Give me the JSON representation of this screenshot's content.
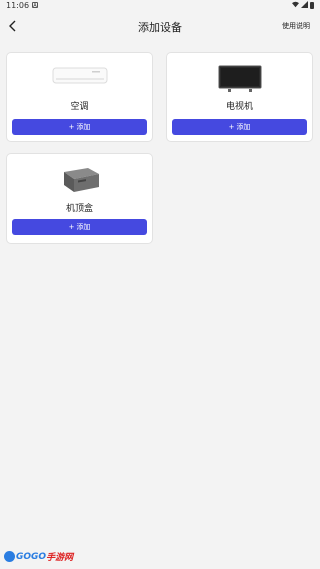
{
  "status": {
    "time": "11:06",
    "notification_icon": "A"
  },
  "header": {
    "title": "添加设备",
    "help_label": "使用说明"
  },
  "devices": [
    {
      "name": "空调",
      "icon": "air-conditioner",
      "button_label": "添加",
      "button_icon": "+"
    },
    {
      "name": "电视机",
      "icon": "television",
      "button_label": "添加",
      "button_icon": "+"
    },
    {
      "name": "机顶盒",
      "icon": "set-top-box",
      "button_label": "添加",
      "button_icon": "+"
    }
  ],
  "colors": {
    "accent": "#4549e0",
    "background": "#f3f3f3"
  },
  "watermark": {
    "brand": "GOGO",
    "site": "手游网"
  }
}
